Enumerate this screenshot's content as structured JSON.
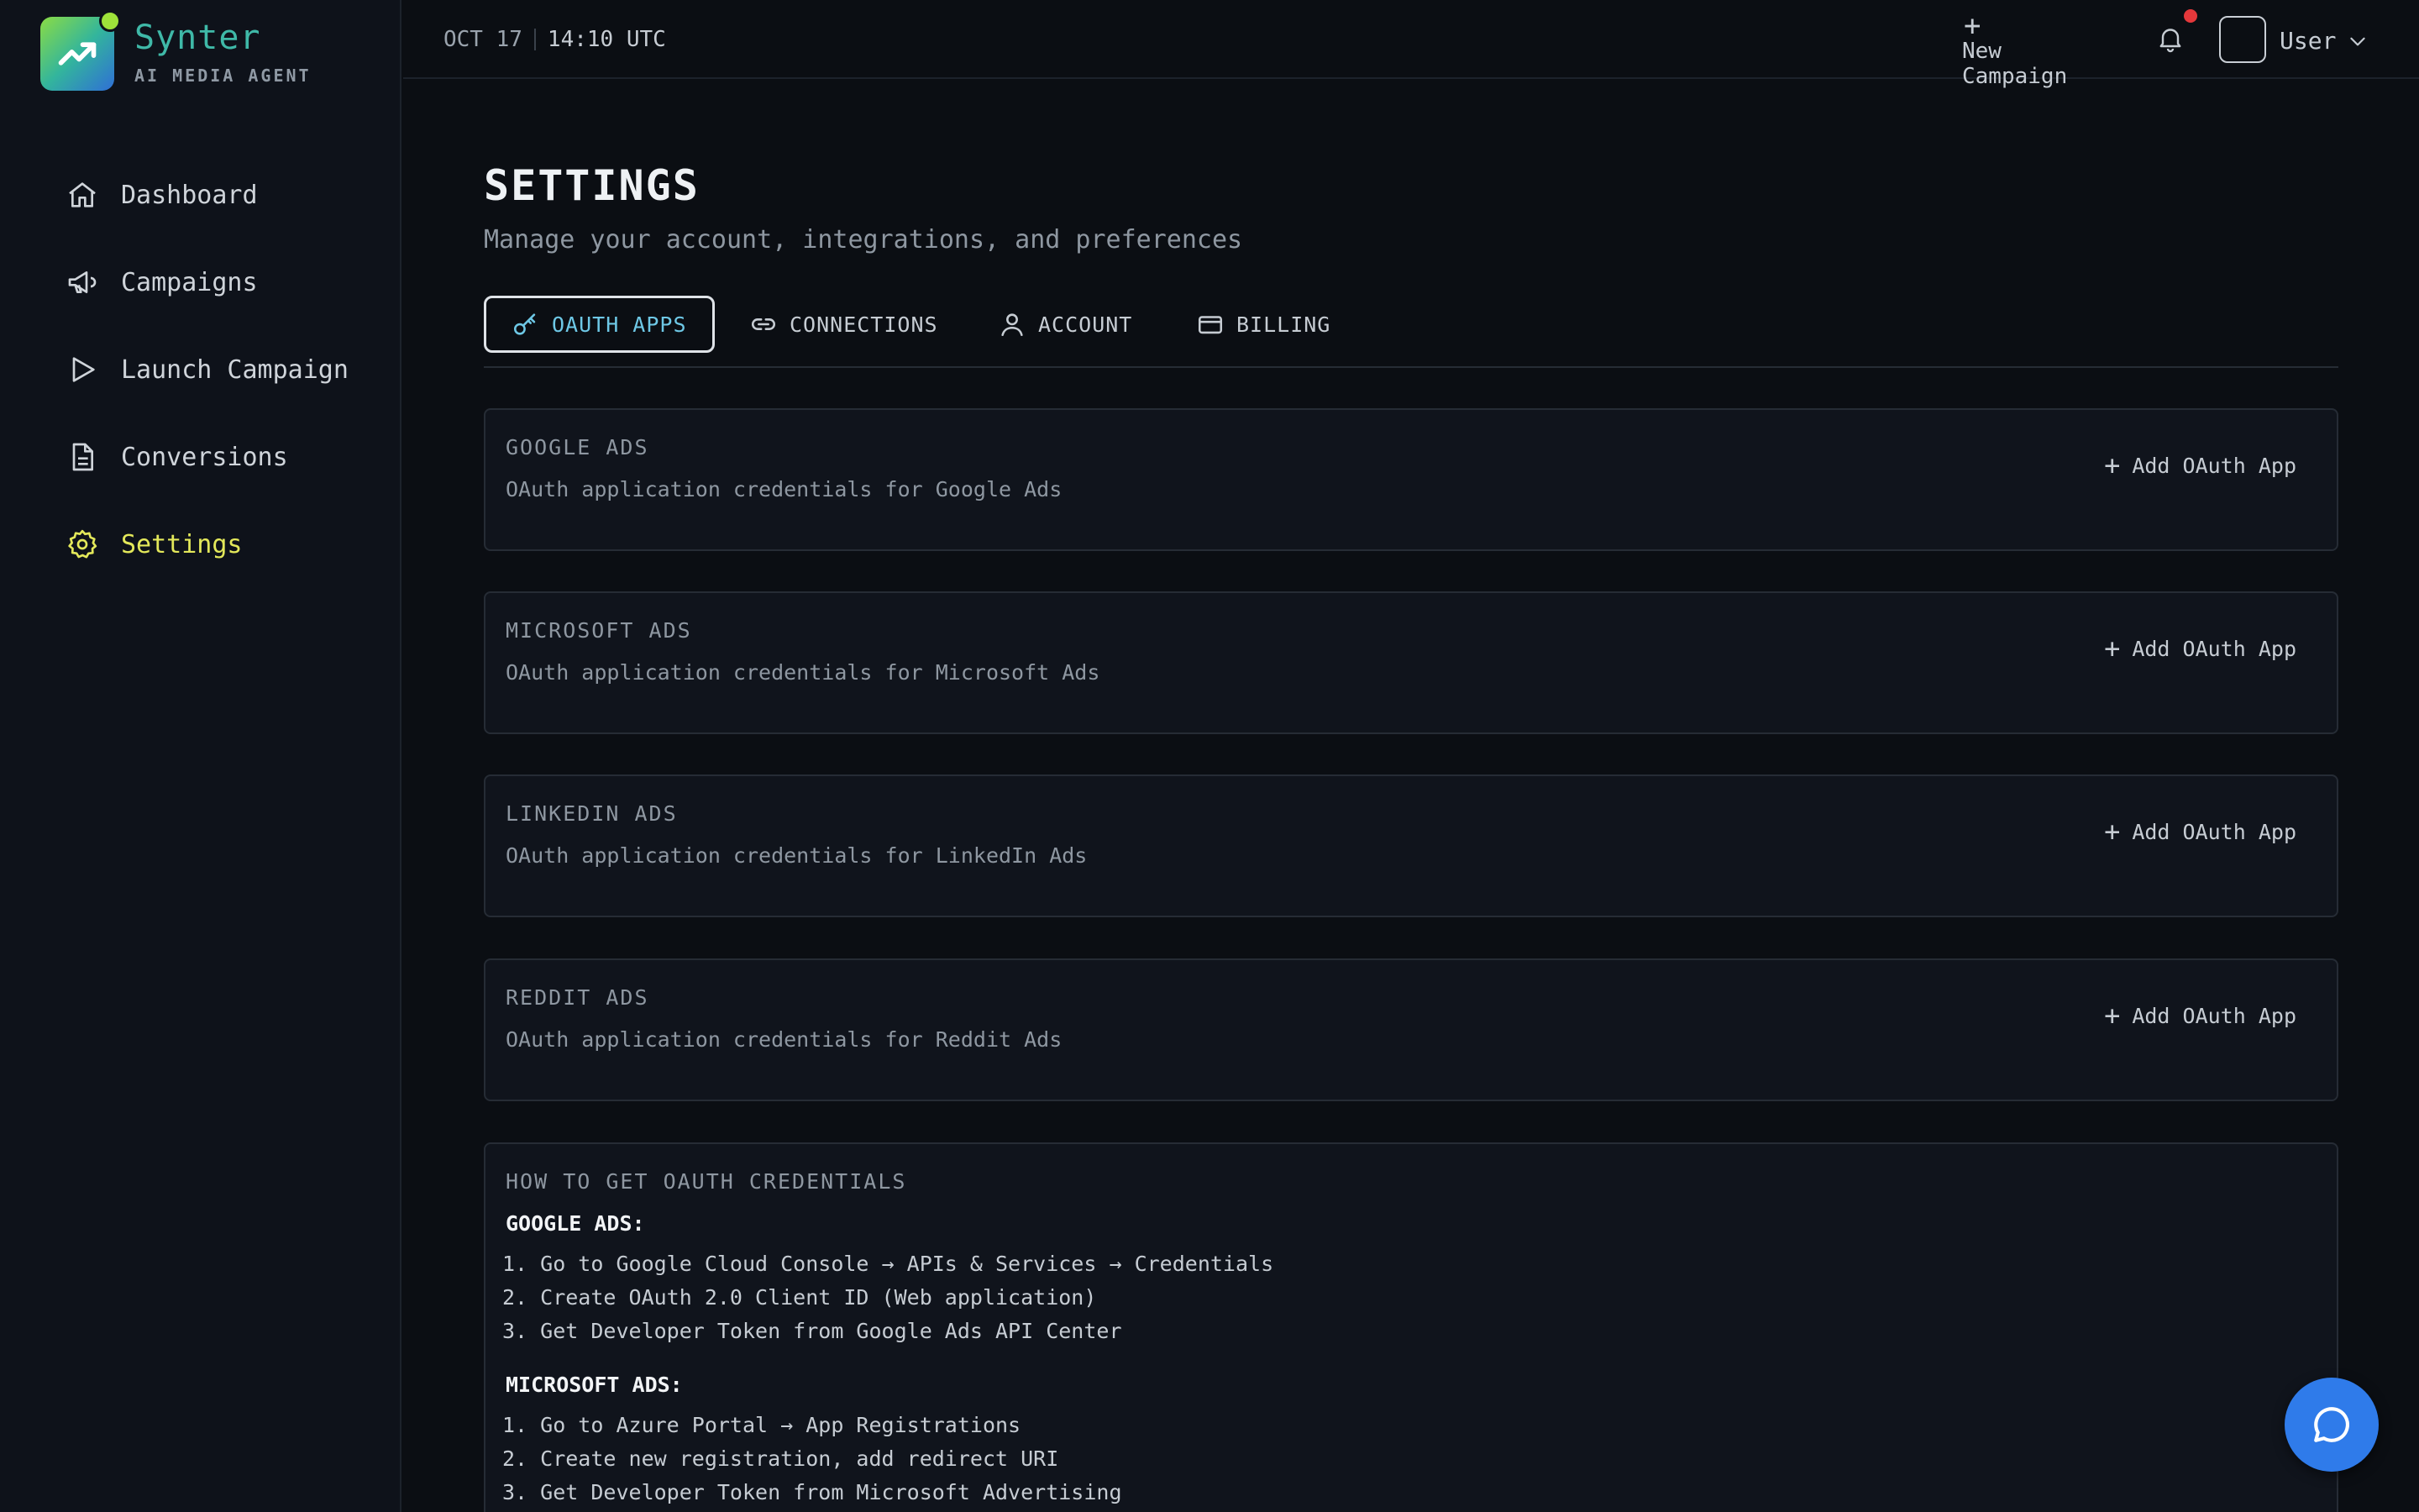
{
  "app": {
    "name": "Synter",
    "tagline": "AI MEDIA AGENT"
  },
  "sidebar": {
    "items": [
      {
        "label": "Dashboard",
        "icon": "home-icon"
      },
      {
        "label": "Campaigns",
        "icon": "megaphone-icon"
      },
      {
        "label": "Launch Campaign",
        "icon": "play-icon"
      },
      {
        "label": "Conversions",
        "icon": "document-icon"
      },
      {
        "label": "Settings",
        "icon": "gear-icon",
        "active": true
      }
    ]
  },
  "topbar": {
    "date": "OCT 17",
    "time": "14:10 UTC",
    "new_campaign_label": "New Campaign",
    "user_label": "User",
    "notifications_unread": true
  },
  "page": {
    "title": "SETTINGS",
    "subtitle": "Manage your account, integrations, and preferences"
  },
  "tabs": [
    {
      "label": "OAUTH APPS",
      "icon": "key-icon",
      "active": true
    },
    {
      "label": "CONNECTIONS",
      "icon": "link-icon"
    },
    {
      "label": "ACCOUNT",
      "icon": "user-icon"
    },
    {
      "label": "BILLING",
      "icon": "credit-card-icon"
    }
  ],
  "providers": [
    {
      "title": "GOOGLE ADS",
      "desc": "OAuth application credentials for Google Ads",
      "action": "Add OAuth App"
    },
    {
      "title": "MICROSOFT ADS",
      "desc": "OAuth application credentials for Microsoft Ads",
      "action": "Add OAuth App"
    },
    {
      "title": "LINKEDIN ADS",
      "desc": "OAuth application credentials for LinkedIn Ads",
      "action": "Add OAuth App"
    },
    {
      "title": "REDDIT ADS",
      "desc": "OAuth application credentials for Reddit Ads",
      "action": "Add OAuth App"
    }
  ],
  "howto": {
    "title": "HOW TO GET OAUTH CREDENTIALS",
    "sections": [
      {
        "heading": "GOOGLE ADS:",
        "steps": [
          "1. Go to Google Cloud Console → APIs & Services → Credentials",
          "2. Create OAuth 2.0 Client ID (Web application)",
          "3. Get Developer Token from Google Ads API Center"
        ]
      },
      {
        "heading": "MICROSOFT ADS:",
        "steps": [
          "1. Go to Azure Portal → App Registrations",
          "2. Create new registration, add redirect URI",
          "3. Get Developer Token from Microsoft Advertising"
        ]
      }
    ]
  },
  "colors": {
    "background": "#0b0e13",
    "accent_active_nav": "#e3e85a",
    "accent_active_tab": "#6ec8e6",
    "chat_button": "#2f7bea",
    "notification_dot": "#e5383b"
  }
}
